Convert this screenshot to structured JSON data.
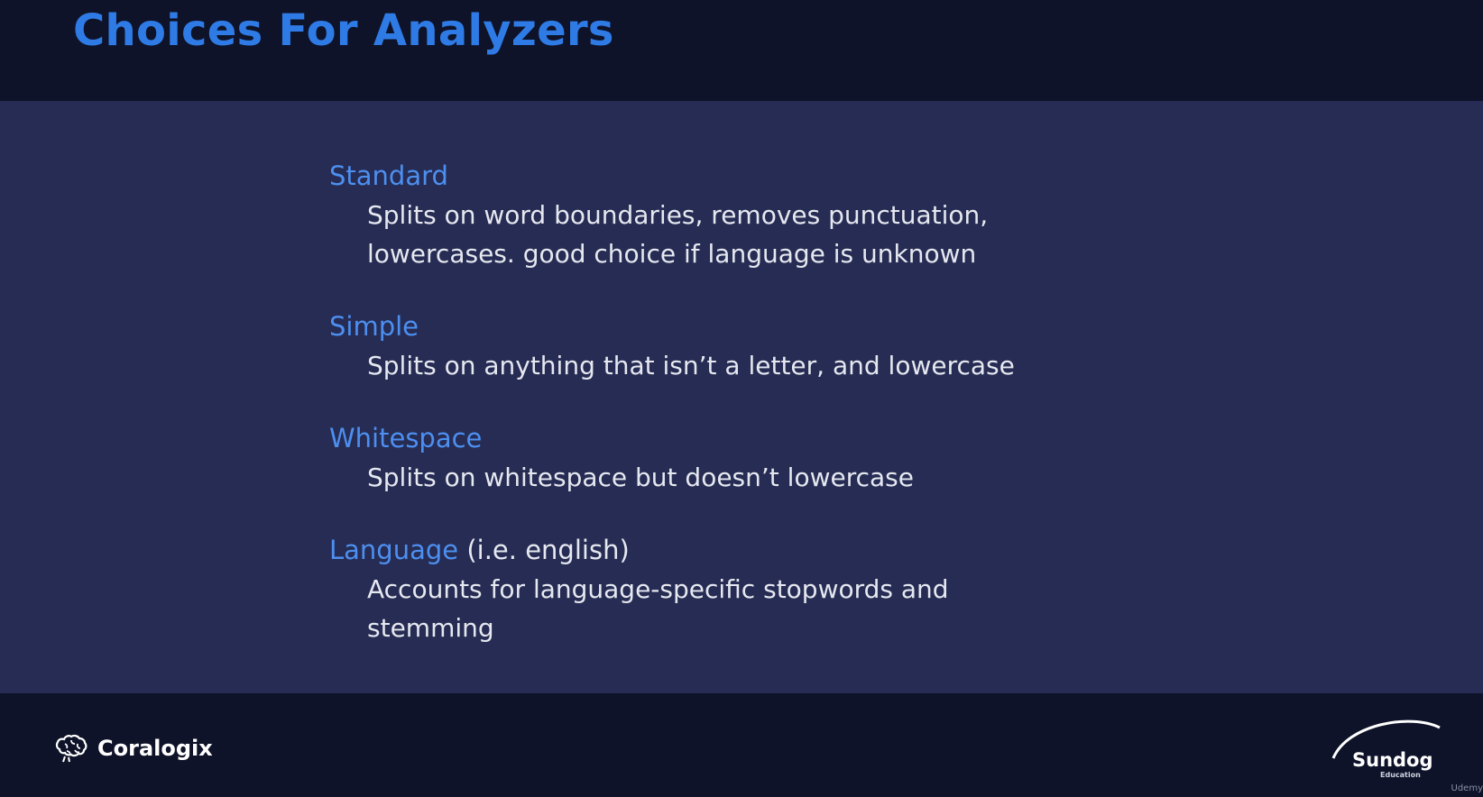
{
  "slide": {
    "title": "Choices For Analyzers"
  },
  "items": [
    {
      "name": "Standard",
      "suffix": "",
      "description": "Splits on word boundaries, removes punctuation, lowercases. good choice if language is unknown"
    },
    {
      "name": "Simple",
      "suffix": "",
      "description": "Splits on anything that isn’t a letter, and lowercase"
    },
    {
      "name": "Whitespace",
      "suffix": "",
      "description": "Splits on whitespace but doesn’t lowercase"
    },
    {
      "name": "Language",
      "suffix": " (i.e. english)",
      "description": "Accounts for language-specific stopwords and stemming"
    }
  ],
  "footer": {
    "left_logo_text": "Coralogix",
    "left_logo_icon": "brain-icon",
    "right_logo_text": "Sundog",
    "right_logo_subtext": "Education",
    "watermark": "Udemy"
  },
  "colors": {
    "title": "#2f7be6",
    "item_title": "#4d8ff0",
    "band": "#262c53",
    "background": "#0e1329",
    "text": "#e6e8f0"
  }
}
